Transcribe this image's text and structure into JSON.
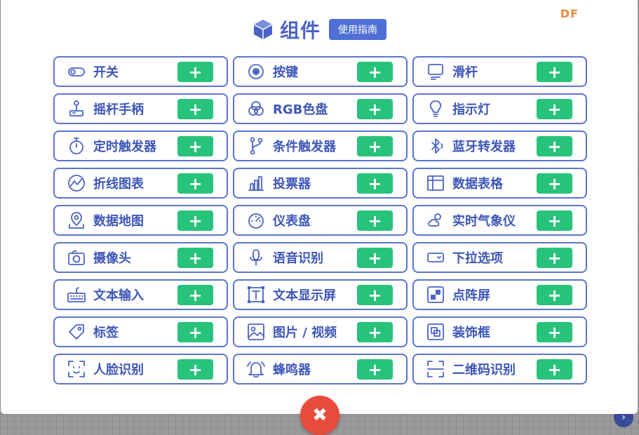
{
  "brand": {
    "mark": "DF"
  },
  "header": {
    "title": "组件",
    "guide_label": "使用指南"
  },
  "components": [
    {
      "label": "开关",
      "icon": "switch-icon",
      "add": "+"
    },
    {
      "label": "按键",
      "icon": "button-icon",
      "add": "+"
    },
    {
      "label": "滑杆",
      "icon": "slider-icon",
      "add": "+"
    },
    {
      "label": "摇杆手柄",
      "icon": "joystick-icon",
      "add": "+"
    },
    {
      "label": "RGB色盘",
      "icon": "rgb-palette-icon",
      "add": "+"
    },
    {
      "label": "指示灯",
      "icon": "bulb-icon",
      "add": "+"
    },
    {
      "label": "定时触发器",
      "icon": "stopwatch-icon",
      "add": "+"
    },
    {
      "label": "条件触发器",
      "icon": "branch-icon",
      "add": "+"
    },
    {
      "label": "蓝牙转发器",
      "icon": "bluetooth-icon",
      "add": "+"
    },
    {
      "label": "折线图表",
      "icon": "line-chart-icon",
      "add": "+"
    },
    {
      "label": "投票器",
      "icon": "bar-chart-icon",
      "add": "+"
    },
    {
      "label": "数据表格",
      "icon": "table-icon",
      "add": "+"
    },
    {
      "label": "数据地图",
      "icon": "map-pin-icon",
      "add": "+"
    },
    {
      "label": "仪表盘",
      "icon": "gauge-icon",
      "add": "+"
    },
    {
      "label": "实时气象仪",
      "icon": "weather-icon",
      "add": "+"
    },
    {
      "label": "摄像头",
      "icon": "camera-icon",
      "add": "+"
    },
    {
      "label": "语音识别",
      "icon": "microphone-icon",
      "add": "+"
    },
    {
      "label": "下拉选项",
      "icon": "dropdown-icon",
      "add": "+"
    },
    {
      "label": "文本输入",
      "icon": "keyboard-icon",
      "add": "+"
    },
    {
      "label": "文本显示屏",
      "icon": "text-box-icon",
      "add": "+"
    },
    {
      "label": "点阵屏",
      "icon": "dot-matrix-icon",
      "add": "+"
    },
    {
      "label": "标签",
      "icon": "tag-icon",
      "add": "+"
    },
    {
      "label": "图片 / 视频",
      "icon": "image-icon",
      "add": "+"
    },
    {
      "label": "装饰框",
      "icon": "frame-icon",
      "add": "+"
    },
    {
      "label": "人脸识别",
      "icon": "face-scan-icon",
      "add": "+"
    },
    {
      "label": "蜂鸣器",
      "icon": "bell-icon",
      "add": "+"
    },
    {
      "label": "二维码识别",
      "icon": "qr-scan-icon",
      "add": "+"
    }
  ],
  "close": {
    "label": "✖"
  },
  "side": {
    "label": "›"
  },
  "colors": {
    "accent": "#4f6fd6",
    "text": "#3d56b8",
    "add": "#27c37b",
    "close": "#e84b3c",
    "brand": "#f08a3c"
  }
}
